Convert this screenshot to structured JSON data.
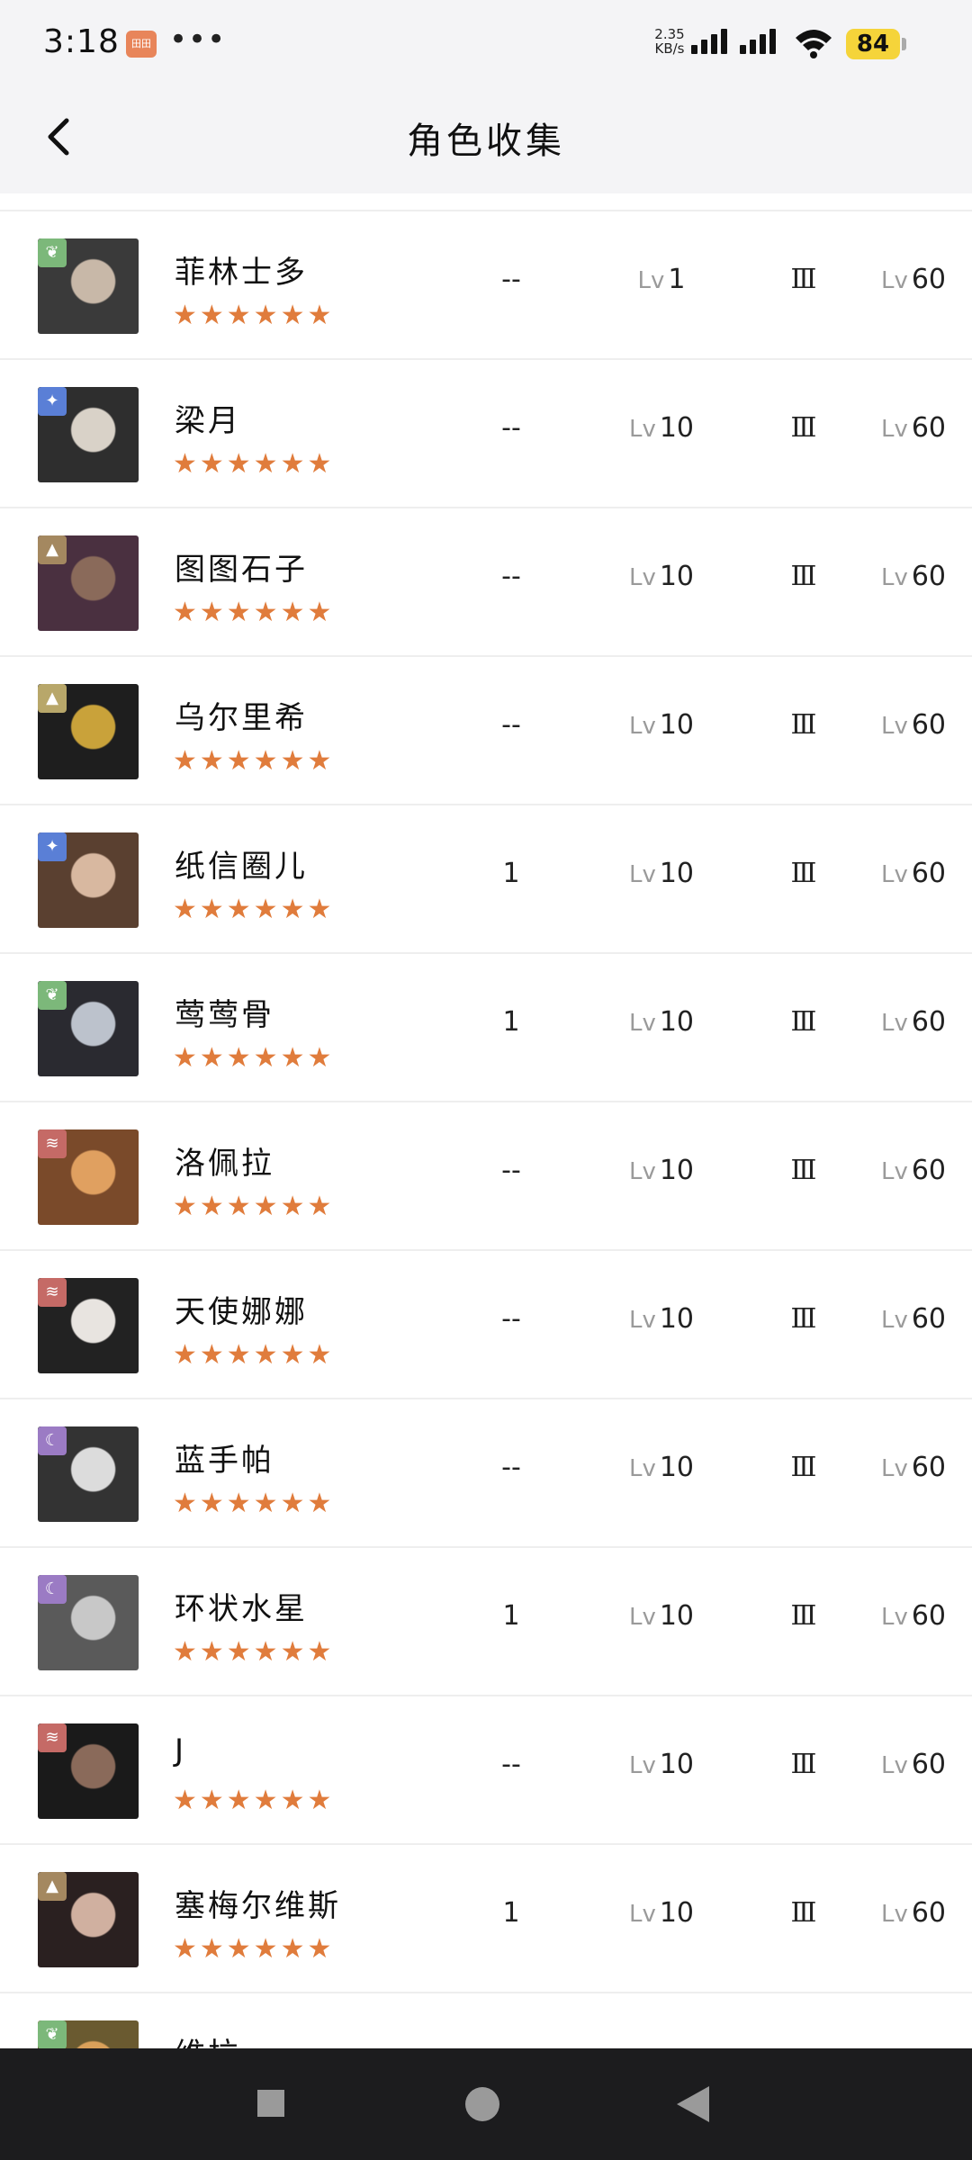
{
  "status_bar": {
    "time": "3:18",
    "app_badge": "田田",
    "more": "•••",
    "net_speed_value": "2.35",
    "net_speed_unit": "KB/s",
    "battery": "84"
  },
  "header": {
    "title": "角色收集"
  },
  "list_columns_prefix": "Lv",
  "characters": [
    {
      "name": "菲林士多",
      "element_icon": "leaf-icon",
      "element_color": "#7cb87a",
      "stars": "★★★★★★",
      "col_a": "--",
      "level": "1",
      "tier": "Ⅲ",
      "max_level": "60"
    },
    {
      "name": "梁月",
      "element_icon": "star-icon",
      "element_color": "#5a7fd6",
      "stars": "★★★★★★",
      "col_a": "--",
      "level": "10",
      "tier": "Ⅲ",
      "max_level": "60"
    },
    {
      "name": "图图石子",
      "element_icon": "mountain-icon",
      "element_color": "#a48860",
      "stars": "★★★★★★",
      "col_a": "--",
      "level": "10",
      "tier": "Ⅲ",
      "max_level": "60"
    },
    {
      "name": "乌尔里希",
      "element_icon": "mountain-icon",
      "element_color": "#b8a76a",
      "stars": "★★★★★★",
      "col_a": "--",
      "level": "10",
      "tier": "Ⅲ",
      "max_level": "60"
    },
    {
      "name": "纸信圈儿",
      "element_icon": "star-icon",
      "element_color": "#5a7fd6",
      "stars": "★★★★★★",
      "col_a": "1",
      "level": "10",
      "tier": "Ⅲ",
      "max_level": "60"
    },
    {
      "name": "莺莺骨",
      "element_icon": "leaf-icon",
      "element_color": "#7cb87a",
      "stars": "★★★★★★",
      "col_a": "1",
      "level": "10",
      "tier": "Ⅲ",
      "max_level": "60"
    },
    {
      "name": "洛佩拉",
      "element_icon": "wind-icon",
      "element_color": "#c56a66",
      "stars": "★★★★★★",
      "col_a": "--",
      "level": "10",
      "tier": "Ⅲ",
      "max_level": "60"
    },
    {
      "name": "天使娜娜",
      "element_icon": "wind-icon",
      "element_color": "#c56a66",
      "stars": "★★★★★★",
      "col_a": "--",
      "level": "10",
      "tier": "Ⅲ",
      "max_level": "60"
    },
    {
      "name": "蓝手帕",
      "element_icon": "moon-icon",
      "element_color": "#9b7bc4",
      "stars": "★★★★★★",
      "col_a": "--",
      "level": "10",
      "tier": "Ⅲ",
      "max_level": "60"
    },
    {
      "name": "环状水星",
      "element_icon": "moon-icon",
      "element_color": "#9b7bc4",
      "stars": "★★★★★★",
      "col_a": "1",
      "level": "10",
      "tier": "Ⅲ",
      "max_level": "60"
    },
    {
      "name": "J",
      "element_icon": "wind-icon",
      "element_color": "#c56a66",
      "stars": "★★★★★★",
      "col_a": "--",
      "level": "10",
      "tier": "Ⅲ",
      "max_level": "60"
    },
    {
      "name": "塞梅尔维斯",
      "element_icon": "mountain-icon",
      "element_color": "#a48860",
      "stars": "★★★★★★",
      "col_a": "1",
      "level": "10",
      "tier": "Ⅲ",
      "max_level": "60"
    },
    {
      "name": "维拉",
      "element_icon": "leaf-icon",
      "element_color": "#7cb87a",
      "stars": "★★★★★★",
      "col_a": "",
      "level": "",
      "tier": "",
      "max_level": ""
    }
  ],
  "nav_bar": {
    "recents_icon": "square-icon",
    "home_icon": "circle-icon",
    "back_icon": "triangle-back-icon"
  }
}
